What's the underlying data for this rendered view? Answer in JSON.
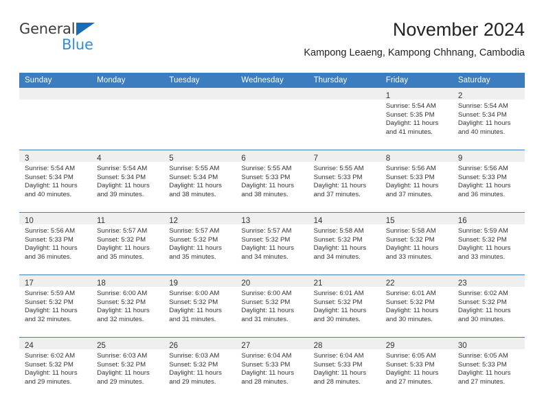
{
  "brand": {
    "name_top": "General",
    "name_bottom": "Blue",
    "accent_color": "#2c8fd6",
    "triangle_color": "#1b6cb5"
  },
  "header": {
    "title": "November 2024",
    "location": "Kampong Leaeng, Kampong Chhnang, Cambodia"
  },
  "calendar": {
    "header_bg": "#3b7dbf",
    "daynum_bg": "#efefef",
    "weekday_names": [
      "Sunday",
      "Monday",
      "Tuesday",
      "Wednesday",
      "Thursday",
      "Friday",
      "Saturday"
    ],
    "weeks": [
      [
        {
          "day": "",
          "lines": []
        },
        {
          "day": "",
          "lines": []
        },
        {
          "day": "",
          "lines": []
        },
        {
          "day": "",
          "lines": []
        },
        {
          "day": "",
          "lines": []
        },
        {
          "day": "1",
          "lines": [
            "Sunrise: 5:54 AM",
            "Sunset: 5:35 PM",
            "Daylight: 11 hours",
            "and 41 minutes."
          ]
        },
        {
          "day": "2",
          "lines": [
            "Sunrise: 5:54 AM",
            "Sunset: 5:34 PM",
            "Daylight: 11 hours",
            "and 40 minutes."
          ]
        }
      ],
      [
        {
          "day": "3",
          "lines": [
            "Sunrise: 5:54 AM",
            "Sunset: 5:34 PM",
            "Daylight: 11 hours",
            "and 40 minutes."
          ]
        },
        {
          "day": "4",
          "lines": [
            "Sunrise: 5:54 AM",
            "Sunset: 5:34 PM",
            "Daylight: 11 hours",
            "and 39 minutes."
          ]
        },
        {
          "day": "5",
          "lines": [
            "Sunrise: 5:55 AM",
            "Sunset: 5:34 PM",
            "Daylight: 11 hours",
            "and 38 minutes."
          ]
        },
        {
          "day": "6",
          "lines": [
            "Sunrise: 5:55 AM",
            "Sunset: 5:33 PM",
            "Daylight: 11 hours",
            "and 38 minutes."
          ]
        },
        {
          "day": "7",
          "lines": [
            "Sunrise: 5:55 AM",
            "Sunset: 5:33 PM",
            "Daylight: 11 hours",
            "and 37 minutes."
          ]
        },
        {
          "day": "8",
          "lines": [
            "Sunrise: 5:56 AM",
            "Sunset: 5:33 PM",
            "Daylight: 11 hours",
            "and 37 minutes."
          ]
        },
        {
          "day": "9",
          "lines": [
            "Sunrise: 5:56 AM",
            "Sunset: 5:33 PM",
            "Daylight: 11 hours",
            "and 36 minutes."
          ]
        }
      ],
      [
        {
          "day": "10",
          "lines": [
            "Sunrise: 5:56 AM",
            "Sunset: 5:33 PM",
            "Daylight: 11 hours",
            "and 36 minutes."
          ]
        },
        {
          "day": "11",
          "lines": [
            "Sunrise: 5:57 AM",
            "Sunset: 5:32 PM",
            "Daylight: 11 hours",
            "and 35 minutes."
          ]
        },
        {
          "day": "12",
          "lines": [
            "Sunrise: 5:57 AM",
            "Sunset: 5:32 PM",
            "Daylight: 11 hours",
            "and 35 minutes."
          ]
        },
        {
          "day": "13",
          "lines": [
            "Sunrise: 5:57 AM",
            "Sunset: 5:32 PM",
            "Daylight: 11 hours",
            "and 34 minutes."
          ]
        },
        {
          "day": "14",
          "lines": [
            "Sunrise: 5:58 AM",
            "Sunset: 5:32 PM",
            "Daylight: 11 hours",
            "and 34 minutes."
          ]
        },
        {
          "day": "15",
          "lines": [
            "Sunrise: 5:58 AM",
            "Sunset: 5:32 PM",
            "Daylight: 11 hours",
            "and 33 minutes."
          ]
        },
        {
          "day": "16",
          "lines": [
            "Sunrise: 5:59 AM",
            "Sunset: 5:32 PM",
            "Daylight: 11 hours",
            "and 33 minutes."
          ]
        }
      ],
      [
        {
          "day": "17",
          "lines": [
            "Sunrise: 5:59 AM",
            "Sunset: 5:32 PM",
            "Daylight: 11 hours",
            "and 32 minutes."
          ]
        },
        {
          "day": "18",
          "lines": [
            "Sunrise: 6:00 AM",
            "Sunset: 5:32 PM",
            "Daylight: 11 hours",
            "and 32 minutes."
          ]
        },
        {
          "day": "19",
          "lines": [
            "Sunrise: 6:00 AM",
            "Sunset: 5:32 PM",
            "Daylight: 11 hours",
            "and 31 minutes."
          ]
        },
        {
          "day": "20",
          "lines": [
            "Sunrise: 6:00 AM",
            "Sunset: 5:32 PM",
            "Daylight: 11 hours",
            "and 31 minutes."
          ]
        },
        {
          "day": "21",
          "lines": [
            "Sunrise: 6:01 AM",
            "Sunset: 5:32 PM",
            "Daylight: 11 hours",
            "and 30 minutes."
          ]
        },
        {
          "day": "22",
          "lines": [
            "Sunrise: 6:01 AM",
            "Sunset: 5:32 PM",
            "Daylight: 11 hours",
            "and 30 minutes."
          ]
        },
        {
          "day": "23",
          "lines": [
            "Sunrise: 6:02 AM",
            "Sunset: 5:32 PM",
            "Daylight: 11 hours",
            "and 30 minutes."
          ]
        }
      ],
      [
        {
          "day": "24",
          "lines": [
            "Sunrise: 6:02 AM",
            "Sunset: 5:32 PM",
            "Daylight: 11 hours",
            "and 29 minutes."
          ]
        },
        {
          "day": "25",
          "lines": [
            "Sunrise: 6:03 AM",
            "Sunset: 5:32 PM",
            "Daylight: 11 hours",
            "and 29 minutes."
          ]
        },
        {
          "day": "26",
          "lines": [
            "Sunrise: 6:03 AM",
            "Sunset: 5:32 PM",
            "Daylight: 11 hours",
            "and 29 minutes."
          ]
        },
        {
          "day": "27",
          "lines": [
            "Sunrise: 6:04 AM",
            "Sunset: 5:33 PM",
            "Daylight: 11 hours",
            "and 28 minutes."
          ]
        },
        {
          "day": "28",
          "lines": [
            "Sunrise: 6:04 AM",
            "Sunset: 5:33 PM",
            "Daylight: 11 hours",
            "and 28 minutes."
          ]
        },
        {
          "day": "29",
          "lines": [
            "Sunrise: 6:05 AM",
            "Sunset: 5:33 PM",
            "Daylight: 11 hours",
            "and 27 minutes."
          ]
        },
        {
          "day": "30",
          "lines": [
            "Sunrise: 6:05 AM",
            "Sunset: 5:33 PM",
            "Daylight: 11 hours",
            "and 27 minutes."
          ]
        }
      ]
    ]
  }
}
